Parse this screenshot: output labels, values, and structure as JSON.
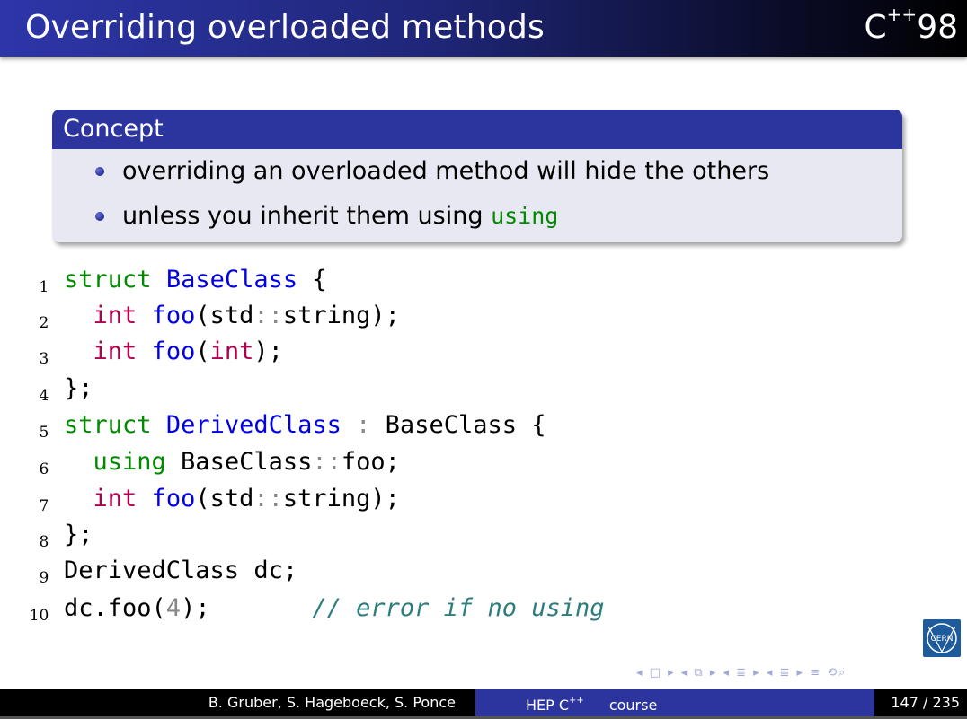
{
  "header": {
    "title": "Overriding overloaded methods",
    "badge_base": "C",
    "badge_sup": "++",
    "badge_version": "98"
  },
  "concept": {
    "title": "Concept",
    "bullet1": "overriding an overloaded method will hide the others",
    "bullet2_text": "unless you inherit them using ",
    "bullet2_code": "using"
  },
  "code": {
    "line_numbers": [
      "1",
      "2",
      "3",
      "4",
      "5",
      "6",
      "7",
      "8",
      "9",
      "10"
    ]
  },
  "footer": {
    "authors": "B. Gruber, S. Hageboeck, S. Ponce",
    "course_prefix": "HEP C",
    "course_sup": "++",
    "course_suffix": "course",
    "page": "147 / 235"
  },
  "logo": {
    "text": "CERN"
  },
  "colors": {
    "theme_blue": "#2c349e",
    "keyword_green": "#008a00",
    "type_blue": "#0000e6",
    "type_red": "#b0004d",
    "comment": "#2e7d7d"
  }
}
